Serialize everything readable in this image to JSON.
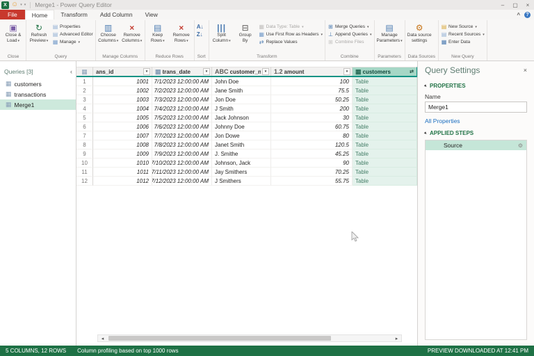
{
  "window": {
    "title": "Merge1 - Power Query Editor"
  },
  "tabs": {
    "file": "File",
    "items": [
      "Home",
      "Transform",
      "Add Column",
      "View"
    ],
    "active": "Home"
  },
  "ribbon": {
    "groups": [
      {
        "label": "Close",
        "items": [
          {
            "type": "big",
            "line1": "Close &",
            "line2": "Load",
            "icon": "save-load",
            "arrow": true
          }
        ]
      },
      {
        "label": "Query",
        "items": [
          {
            "type": "big",
            "line1": "Refresh",
            "line2": "Preview",
            "icon": "refresh",
            "arrow": true
          },
          {
            "type": "column",
            "buttons": [
              {
                "label": "Properties",
                "icon": "page"
              },
              {
                "label": "Advanced Editor",
                "icon": "page-edit"
              },
              {
                "label": "Manage",
                "icon": "table-blue",
                "arrow": true
              }
            ]
          }
        ]
      },
      {
        "label": "Manage Columns",
        "items": [
          {
            "type": "big",
            "line1": "Choose",
            "line2": "Columns",
            "icon": "columns-choose",
            "arrow": true
          },
          {
            "type": "big",
            "line1": "Remove",
            "line2": "Columns",
            "icon": "x-red",
            "arrow": true
          }
        ]
      },
      {
        "label": "Reduce Rows",
        "items": [
          {
            "type": "big",
            "line1": "Keep",
            "line2": "Rows",
            "icon": "rows-keep",
            "arrow": true
          },
          {
            "type": "big",
            "line1": "Remove",
            "line2": "Rows",
            "icon": "x-red",
            "arrow": true
          }
        ]
      },
      {
        "label": "Sort",
        "items": [
          {
            "type": "column",
            "buttons": [
              {
                "label": "",
                "icon": "sort-asc"
              },
              {
                "label": "",
                "icon": "sort-desc"
              }
            ]
          }
        ]
      },
      {
        "label": "Transform",
        "items": [
          {
            "type": "big",
            "line1": "Split",
            "line2": "Column",
            "icon": "split-column",
            "arrow": true
          },
          {
            "type": "big",
            "line1": "Group",
            "line2": "By",
            "icon": "group-by"
          },
          {
            "type": "column",
            "buttons": [
              {
                "label": "Data Type: Table",
                "icon": "data-type",
                "arrow": true,
                "disabled": true
              },
              {
                "label": "Use First Row as Headers",
                "icon": "first-row-headers",
                "arrow": true
              },
              {
                "label": "Replace Values",
                "icon": "replace-values"
              }
            ]
          }
        ]
      },
      {
        "label": "Combine",
        "items": [
          {
            "type": "column",
            "buttons": [
              {
                "label": "Merge Queries",
                "icon": "merge-queries",
                "arrow": true
              },
              {
                "label": "Append Queries",
                "icon": "append-queries",
                "arrow": true
              },
              {
                "label": "Combine Files",
                "icon": "combine-files",
                "disabled": true
              }
            ]
          }
        ]
      },
      {
        "label": "Parameters",
        "items": [
          {
            "type": "big",
            "line1": "Manage",
            "line2": "Parameters",
            "icon": "manage-parameters",
            "arrow": true
          }
        ]
      },
      {
        "label": "Data Sources",
        "items": [
          {
            "type": "big",
            "line1": "Data source",
            "line2": "settings",
            "icon": "data-source-gear"
          }
        ]
      },
      {
        "label": "New Query",
        "items": [
          {
            "type": "column",
            "buttons": [
              {
                "label": "New Source",
                "icon": "new-source",
                "arrow": true
              },
              {
                "label": "Recent Sources",
                "icon": "recent-sources",
                "arrow": true
              },
              {
                "label": "Enter Data",
                "icon": "enter-data"
              }
            ]
          }
        ]
      }
    ]
  },
  "queries_panel": {
    "title": "Queries [3]",
    "items": [
      {
        "name": "customers",
        "selected": false
      },
      {
        "name": "transactions",
        "selected": false
      },
      {
        "name": "Merge1",
        "selected": true
      }
    ]
  },
  "table": {
    "columns": [
      {
        "label": "ans_id",
        "icon": null,
        "align": "right",
        "italic": true,
        "control": "filter"
      },
      {
        "label": "trans_date",
        "icon": "calendar",
        "align": "right",
        "italic": true,
        "control": "filter"
      },
      {
        "label": "customer_name",
        "icon": "abc",
        "align": "left",
        "italic": false,
        "control": "filter"
      },
      {
        "label": "amount",
        "icon": "number-12",
        "align": "right",
        "italic": true,
        "control": "filter"
      },
      {
        "label": "customers",
        "icon": "table-green",
        "align": "left",
        "italic": false,
        "control": "expand",
        "selected": true
      }
    ],
    "rows": [
      [
        "1001",
        "7/1/2023 12:00:00 AM",
        "John Doe",
        "100",
        "Table"
      ],
      [
        "1002",
        "7/2/2023 12:00:00 AM",
        "Jane Smith",
        "75.5",
        "Table"
      ],
      [
        "1003",
        "7/3/2023 12:00:00 AM",
        "Jon Doe",
        "50.25",
        "Table"
      ],
      [
        "1004",
        "7/4/2023 12:00:00 AM",
        "J Smith",
        "200",
        "Table"
      ],
      [
        "1005",
        "7/5/2023 12:00:00 AM",
        "Jack Johnson",
        "30",
        "Table"
      ],
      [
        "1006",
        "7/6/2023 12:00:00 AM",
        "Johnny Doe",
        "60.75",
        "Table"
      ],
      [
        "1007",
        "7/7/2023 12:00:00 AM",
        "Jon Dowe",
        "80",
        "Table"
      ],
      [
        "1008",
        "7/8/2023 12:00:00 AM",
        "Janet Smith",
        "120.5",
        "Table"
      ],
      [
        "1009",
        "7/9/2023 12:00:00 AM",
        "J. Smithe",
        "45.25",
        "Table"
      ],
      [
        "1010",
        "7/10/2023 12:00:00 AM",
        "Johnson, Jack",
        "90",
        "Table"
      ],
      [
        "1011",
        "7/11/2023 12:00:00 AM",
        "Jay Smithers",
        "70.25",
        "Table"
      ],
      [
        "1012",
        "7/12/2023 12:00:00 AM",
        "J Smithers",
        "55.75",
        "Table"
      ]
    ]
  },
  "query_settings": {
    "title": "Query Settings",
    "properties_header": "PROPERTIES",
    "name_label": "Name",
    "name_value": "Merge1",
    "all_properties_link": "All Properties",
    "applied_steps_header": "APPLIED STEPS",
    "steps": [
      {
        "name": "Source",
        "selected": true
      }
    ]
  },
  "status_bar": {
    "columns_rows": "5 COLUMNS, 12 ROWS",
    "profiling": "Column profiling based on top 1000 rows",
    "preview": "PREVIEW DOWNLOADED AT 12:41 PM"
  },
  "colors": {
    "accent_green": "#217346",
    "status_bar_green": "#1e7145",
    "file_tab_red": "#c8382d",
    "selected_column_teal": "#a6d7c6",
    "quality_bar_teal": "#0d9384",
    "selected_item_green": "#cde9dc"
  },
  "icons": {
    "excel-logo": {
      "g": "X",
      "c": "#ffffff"
    },
    "smiley": {
      "g": "☺",
      "c": "#e8a33d"
    },
    "qat-dropdown": {
      "g": "▾",
      "c": "#8a8886"
    },
    "minimize": {
      "g": "–",
      "c": "#5f5d5b"
    },
    "maximize": {
      "g": "▢",
      "c": "#5f5d5b"
    },
    "close-window": {
      "g": "×",
      "c": "#5f5d5b"
    },
    "collapse-ribbon": {
      "g": "^",
      "c": "#5f5d5b"
    },
    "help": {
      "g": "?",
      "c": "#ffffff"
    },
    "save-load": {
      "g": "▣",
      "c": "#7b5ea7"
    },
    "refresh": {
      "g": "↻",
      "c": "#217346"
    },
    "page": {
      "g": "▤",
      "c": "#92b0d4"
    },
    "page-edit": {
      "g": "▤",
      "c": "#92b0d4"
    },
    "table-blue": {
      "g": "▦",
      "c": "#7ba0cc"
    },
    "columns-choose": {
      "g": "▥",
      "c": "#4a7ab0"
    },
    "x-red": {
      "g": "×",
      "c": "#c43e32"
    },
    "rows-keep": {
      "g": "▤",
      "c": "#4a7ab0"
    },
    "sort-asc": {
      "g": "A↓",
      "c": "#3d6da6"
    },
    "sort-desc": {
      "g": "Z↓",
      "c": "#3d6da6"
    },
    "split-column": {
      "g": "|||",
      "c": "#4a7ab0"
    },
    "group-by": {
      "g": "⊟",
      "c": "#5a5856"
    },
    "data-type": {
      "g": "▦",
      "c": "#b5b3b1"
    },
    "first-row-headers": {
      "g": "▦",
      "c": "#7ba0cc"
    },
    "replace-values": {
      "g": "⇄",
      "c": "#4a7ab0"
    },
    "merge-queries": {
      "g": "⊞",
      "c": "#4a7ab0"
    },
    "append-queries": {
      "g": "⊥",
      "c": "#4a7ab0"
    },
    "combine-files": {
      "g": "⊞",
      "c": "#b5b3b1"
    },
    "manage-parameters": {
      "g": "▤",
      "c": "#4a7ab0"
    },
    "data-source-gear": {
      "g": "⚙",
      "c": "#c77418"
    },
    "new-source": {
      "g": "▤",
      "c": "#d9a93f"
    },
    "recent-sources": {
      "g": "▤",
      "c": "#92b0d4"
    },
    "enter-data": {
      "g": "▦",
      "c": "#4a7ab0"
    },
    "dropdown": {
      "g": "▾",
      "c": "#5f5d5b"
    },
    "query-table": {
      "g": "▦",
      "c": "#8aa0b8"
    },
    "corner-table": {
      "g": "▦",
      "c": "#8aa0b8"
    },
    "calendar": {
      "g": "▦",
      "c": "#8aa0b8"
    },
    "abc": {
      "g": "ABC",
      "c": "#605e5c"
    },
    "number-12": {
      "g": "1.2",
      "c": "#605e5c"
    },
    "table-green": {
      "g": "▦",
      "c": "#2c6e5a"
    },
    "filter": {
      "g": "▾",
      "c": "#444444"
    },
    "expand-column": {
      "g": "⇄",
      "c": "#1d4d3f"
    },
    "collapse-pane": {
      "g": "‹",
      "c": "#605e5c"
    },
    "close-pane": {
      "g": "×",
      "c": "#605e5c"
    },
    "section-expander": {
      "g": "▾",
      "c": "#3b3a39"
    },
    "gear": {
      "g": "⚙",
      "c": "#8a8886"
    },
    "scroll-left": {
      "g": "◂",
      "c": "#555555"
    },
    "scroll-right": {
      "g": "▸",
      "c": "#555555"
    }
  }
}
